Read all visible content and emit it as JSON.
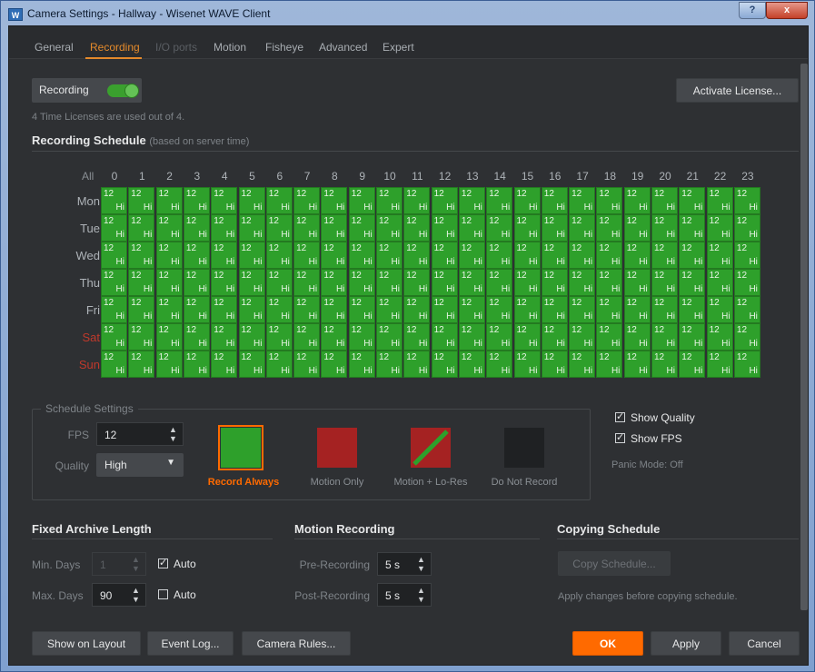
{
  "window": {
    "title": "Camera Settings - Hallway - Wisenet WAVE Client",
    "app_icon": "W",
    "help_label": "?",
    "close_label": "x"
  },
  "tabs": [
    {
      "label": "General",
      "state": "normal"
    },
    {
      "label": "Recording",
      "state": "active"
    },
    {
      "label": "I/O ports",
      "state": "disabled"
    },
    {
      "label": "Motion",
      "state": "normal"
    },
    {
      "label": "Fisheye",
      "state": "normal"
    },
    {
      "label": "Advanced",
      "state": "normal"
    },
    {
      "label": "Expert",
      "state": "normal"
    }
  ],
  "recording": {
    "toggle_label": "Recording",
    "enabled": true,
    "activate_license": "Activate License...",
    "license_note": "4 Time Licenses are used out of 4."
  },
  "schedule": {
    "title": "Recording Schedule",
    "subtitle": "(based on server time)",
    "all_label": "All",
    "hours": [
      "0",
      "1",
      "2",
      "3",
      "4",
      "5",
      "6",
      "7",
      "8",
      "9",
      "10",
      "11",
      "12",
      "13",
      "14",
      "15",
      "16",
      "17",
      "18",
      "19",
      "20",
      "21",
      "22",
      "23"
    ],
    "days": [
      {
        "label": "Mon",
        "weekend": false
      },
      {
        "label": "Tue",
        "weekend": false
      },
      {
        "label": "Wed",
        "weekend": false
      },
      {
        "label": "Thu",
        "weekend": false
      },
      {
        "label": "Fri",
        "weekend": false
      },
      {
        "label": "Sat",
        "weekend": true
      },
      {
        "label": "Sun",
        "weekend": true
      }
    ],
    "cell_fps": "12",
    "cell_quality": "Hi",
    "cell_color": "#2ea02b"
  },
  "schedule_settings": {
    "title": "Schedule Settings",
    "fps_label": "FPS",
    "fps_value": "12",
    "quality_label": "Quality",
    "quality_value": "High",
    "modes": [
      {
        "label": "Record Always",
        "color": "#2ea02b",
        "selected": true,
        "icon": "solid"
      },
      {
        "label": "Motion Only",
        "color": "#a52222",
        "selected": false,
        "icon": "solid"
      },
      {
        "label": "Motion + Lo-Res",
        "color": "#a52222",
        "selected": false,
        "icon": "diagonal-green"
      },
      {
        "label": "Do Not Record",
        "color": "#1f2123",
        "selected": false,
        "icon": "solid"
      }
    ],
    "show_quality": "Show Quality",
    "show_fps": "Show FPS",
    "panic_mode": "Panic Mode: Off"
  },
  "archive": {
    "title": "Fixed Archive Length",
    "min_label": "Min. Days",
    "min_value": "1",
    "min_auto": "Auto",
    "max_label": "Max. Days",
    "max_value": "90",
    "max_auto": "Auto"
  },
  "motion": {
    "title": "Motion Recording",
    "pre_label": "Pre-Recording",
    "pre_value": "5 s",
    "post_label": "Post-Recording",
    "post_value": "5 s"
  },
  "copying": {
    "title": "Copying Schedule",
    "copy_button": "Copy Schedule...",
    "note": "Apply changes before copying schedule."
  },
  "footer": {
    "show_on_layout": "Show on Layout",
    "event_log": "Event Log...",
    "camera_rules": "Camera Rules...",
    "ok": "OK",
    "apply": "Apply",
    "cancel": "Cancel"
  }
}
